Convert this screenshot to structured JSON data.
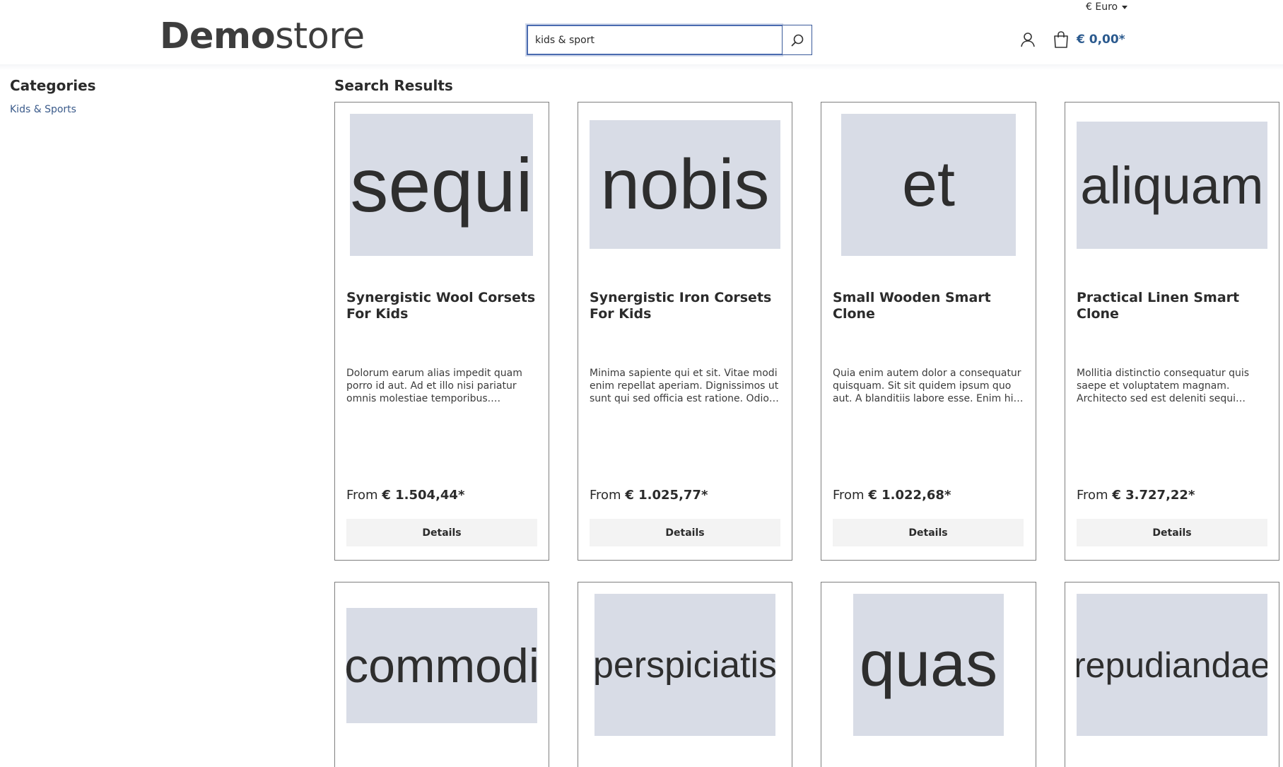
{
  "header": {
    "currency": "€ Euro",
    "logo_bold": "Demo",
    "logo_light": "store",
    "search_value": "kids & sport",
    "cart_total": "€ 0,00*"
  },
  "sidebar": {
    "title": "Categories",
    "items": [
      {
        "label": "Kids & Sports"
      }
    ]
  },
  "main": {
    "title": "Search Results",
    "products": [
      {
        "image_text": "sequi",
        "name": "Synergistic Wool Corsets For Kids",
        "description": "Dolorum earum alias impedit quam porro id aut. Ad et illo nisi pariatur omnis molestiae temporibus. Consequatur odio amet eos tempore.",
        "price_prefix": "From",
        "price": "€ 1.504,44*",
        "button": "Details"
      },
      {
        "image_text": "nobis",
        "name": "Synergistic Iron Corsets For Kids",
        "description": "Minima sapiente qui et sit. Vitae modi enim repellat aperiam. Dignissimos ut sunt qui sed officia est ratione. Odio est ipsum.",
        "price_prefix": "From",
        "price": "€ 1.025,77*",
        "button": "Details"
      },
      {
        "image_text": "et",
        "name": "Small Wooden Smart Clone",
        "description": "Quia enim autem dolor a consequatur quisquam. Sit sit quidem ipsum quo aut. A blanditiis labore esse. Enim hic labore et.",
        "price_prefix": "From",
        "price": "€ 1.022,68*",
        "button": "Details"
      },
      {
        "image_text": "aliquam",
        "name": "Practical Linen Smart Clone",
        "description": "Mollitia distinctio consequatur quis saepe et voluptatem magnam. Architecto sed est deleniti sequi dolores.",
        "price_prefix": "From",
        "price": "€ 3.727,22*",
        "button": "Details"
      },
      {
        "image_text": "commodi"
      },
      {
        "image_text": "perspiciatis"
      },
      {
        "image_text": "quas"
      },
      {
        "image_text": "repudiandae"
      }
    ]
  }
}
